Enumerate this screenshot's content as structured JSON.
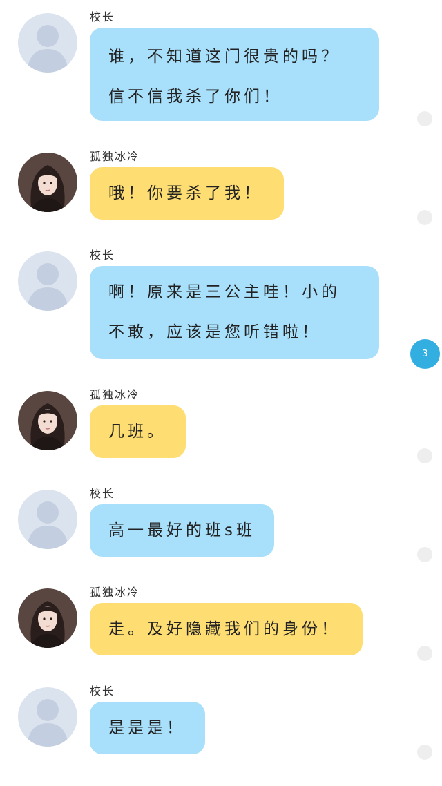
{
  "colors": {
    "blue_bubble": "#a8dffa",
    "yellow_bubble": "#fedd72",
    "unread_badge": "#33aee1",
    "read_dot": "#eeeeee"
  },
  "messages": [
    {
      "sender": "校长",
      "avatar": "default-person-icon",
      "lines": [
        "谁，不知道这门很贵的吗？",
        "信不信我杀了你们！"
      ]
    },
    {
      "sender": "孤独冰冷",
      "avatar": "girl-photo-avatar",
      "lines": [
        "哦！你要杀了我！"
      ]
    },
    {
      "sender": "校长",
      "avatar": "default-person-icon",
      "lines": [
        "啊！原来是三公主哇！小的",
        "不敢，应该是您听错啦！"
      ],
      "unread_count": "3"
    },
    {
      "sender": "孤独冰冷",
      "avatar": "girl-photo-avatar",
      "lines": [
        "几班。"
      ]
    },
    {
      "sender": "校长",
      "avatar": "default-person-icon",
      "lines": [
        "高一最好的班s班"
      ]
    },
    {
      "sender": "孤独冰冷",
      "avatar": "girl-photo-avatar",
      "lines": [
        "走。及好隐藏我们的身份！"
      ]
    },
    {
      "sender": "校长",
      "avatar": "default-person-icon",
      "lines": [
        "是是是！"
      ]
    }
  ]
}
